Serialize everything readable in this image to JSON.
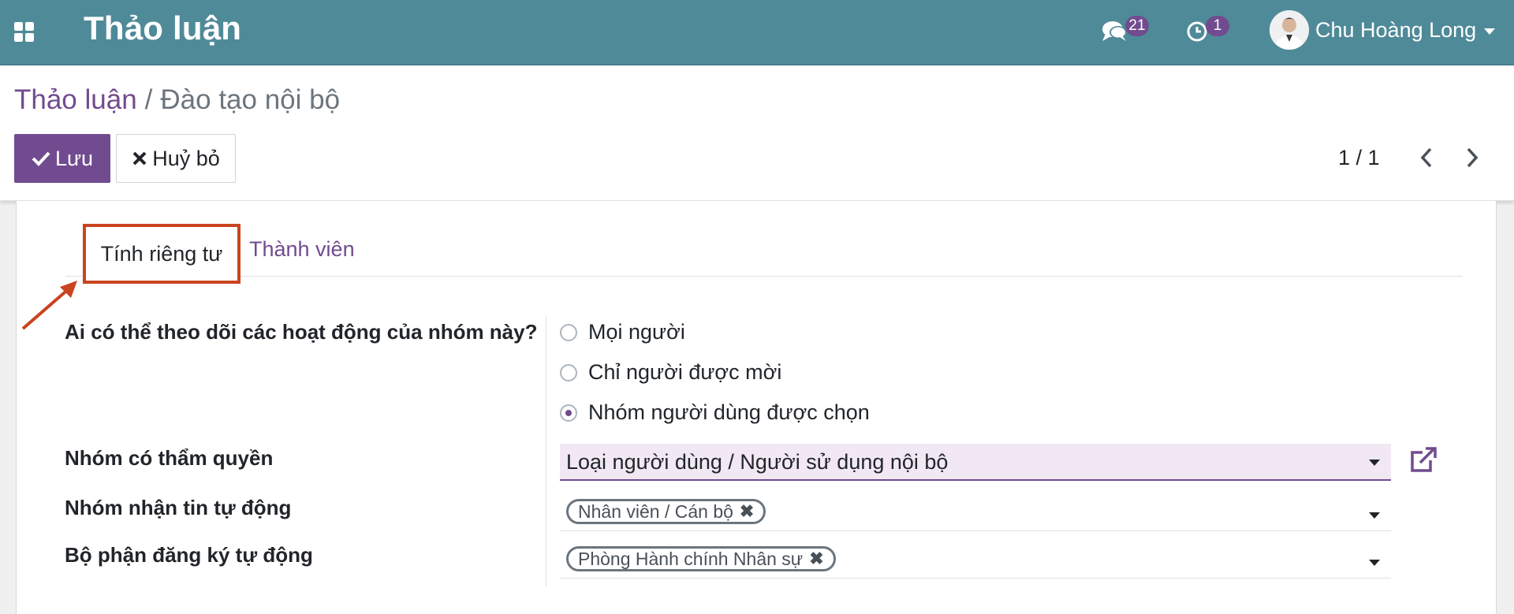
{
  "navbar": {
    "app_title": "Thảo luận",
    "messages_count": "21",
    "activities_count": "1",
    "user_name": "Chu Hoàng Long",
    "icons": [
      "apps-grid-icon",
      "chat-icon",
      "clock-icon",
      "avatar",
      "caret-down-icon"
    ]
  },
  "breadcrumb": {
    "parent": "Thảo luận",
    "separator": "/",
    "current": "Đào tạo nội bộ"
  },
  "buttons": {
    "save": "Lưu",
    "discard": "Huỷ bỏ"
  },
  "pager": {
    "value": "1 / 1"
  },
  "tabs": [
    {
      "label": "Tính riêng tư",
      "active": true
    },
    {
      "label": "Thành viên",
      "active": false
    }
  ],
  "form": {
    "privacy_label": "Ai có thể theo dõi các hoạt động của nhóm này?",
    "privacy_options": [
      {
        "label": "Mọi người",
        "checked": false
      },
      {
        "label": "Chỉ người được mời",
        "checked": false
      },
      {
        "label": "Nhóm người dùng được chọn",
        "checked": true
      }
    ],
    "authorized_group_label": "Nhóm có thẩm quyền",
    "authorized_group_value": "Loại người dùng / Người sử dụng nội bộ",
    "auto_subscribe_groups_label": "Nhóm nhận tin tự động",
    "auto_subscribe_groups_tags": [
      "Nhân viên / Cán bộ"
    ],
    "auto_subscribe_departments_label": "Bộ phận đăng ký tự động",
    "auto_subscribe_departments_tags": [
      "Phòng Hành chính Nhân sự"
    ]
  },
  "colors": {
    "navbar": "#4f8a98",
    "primary": "#714b8f",
    "annotation": "#c9441f"
  }
}
